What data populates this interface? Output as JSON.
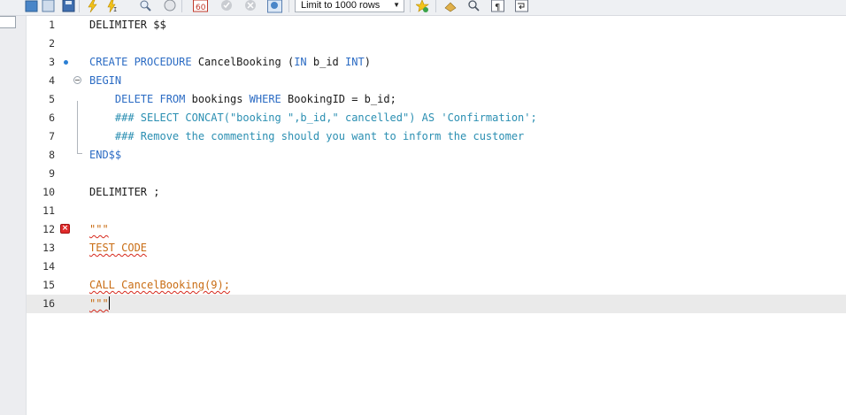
{
  "toolbar": {
    "limit_select_value": "Limit to 1000 rows",
    "icons": [
      "folder-icon",
      "save-icon",
      "execute-icon",
      "execute-current-icon",
      "explain-icon",
      "stop-icon",
      "toggle-results-icon",
      "commit-icon",
      "rollback-icon",
      "autocommit-icon",
      "bookmark-icon",
      "beautify-icon",
      "find-icon",
      "invisible-chars-icon",
      "wrap-icon"
    ]
  },
  "editor": {
    "lines": [
      {
        "n": "1",
        "parts": [
          {
            "t": "DELIMITER $$",
            "c": "plain"
          }
        ]
      },
      {
        "n": "2",
        "parts": []
      },
      {
        "n": "3",
        "parts": [
          {
            "t": "CREATE PROCEDURE",
            "c": "kw"
          },
          {
            "t": " CancelBooking (",
            "c": "plain"
          },
          {
            "t": "IN",
            "c": "kw"
          },
          {
            "t": " b_id ",
            "c": "plain"
          },
          {
            "t": "INT",
            "c": "kw"
          },
          {
            "t": ")",
            "c": "plain"
          }
        ]
      },
      {
        "n": "4",
        "parts": [
          {
            "t": "BEGIN",
            "c": "kw"
          }
        ]
      },
      {
        "n": "5",
        "parts": [
          {
            "t": "    ",
            "c": "plain"
          },
          {
            "t": "DELETE FROM",
            "c": "kw"
          },
          {
            "t": " bookings ",
            "c": "plain"
          },
          {
            "t": "WHERE",
            "c": "kw"
          },
          {
            "t": " BookingID = b_id;",
            "c": "plain"
          }
        ]
      },
      {
        "n": "6",
        "parts": [
          {
            "t": "    ### SELECT CONCAT(\"booking \",b_id,\" cancelled\") AS 'Confirmation';",
            "c": "cm"
          }
        ]
      },
      {
        "n": "7",
        "parts": [
          {
            "t": "    ### Remove the commenting should you want to inform the customer",
            "c": "cm"
          }
        ]
      },
      {
        "n": "8",
        "parts": [
          {
            "t": "END$$",
            "c": "kw"
          }
        ]
      },
      {
        "n": "9",
        "parts": []
      },
      {
        "n": "10",
        "parts": [
          {
            "t": "DELIMITER ;",
            "c": "plain"
          }
        ]
      },
      {
        "n": "11",
        "parts": []
      },
      {
        "n": "12",
        "parts": [
          {
            "t": "\"\"\"",
            "c": "str err"
          }
        ]
      },
      {
        "n": "13",
        "parts": [
          {
            "t": "TEST CODE",
            "c": "str err"
          }
        ]
      },
      {
        "n": "14",
        "parts": []
      },
      {
        "n": "15",
        "parts": [
          {
            "t": "CALL CancelBooking(9);",
            "c": "str err"
          }
        ]
      },
      {
        "n": "16",
        "parts": [
          {
            "t": "\"\"\"",
            "c": "str err"
          }
        ]
      }
    ]
  },
  "colors": {
    "keyword": "#2c6cc4",
    "comment": "#2b8fb2",
    "string": "#c96d14",
    "error": "#e02a2a",
    "breakpoint": "#2a7fd4",
    "current_line": "#eaeaea"
  }
}
